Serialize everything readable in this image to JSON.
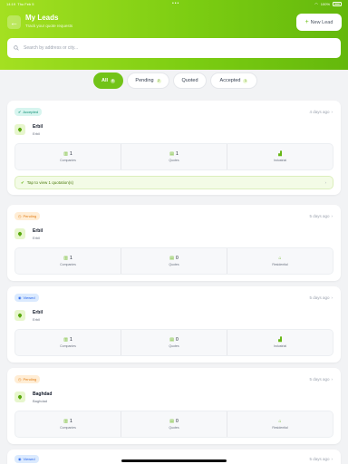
{
  "status_bar": {
    "time": "14:19",
    "date": "Thu Feb 5",
    "dots": "•••",
    "battery": "100%"
  },
  "header": {
    "title": "My Leads",
    "subtitle": "Track your quote requests",
    "new_lead_label": "New Lead",
    "back_icon": "arrow-left-icon"
  },
  "search": {
    "placeholder": "Search by address or city..."
  },
  "tabs": [
    {
      "label": "All",
      "count": "6",
      "active": true
    },
    {
      "label": "Pending",
      "count": "2",
      "active": false
    },
    {
      "label": "Quoted",
      "count": "",
      "active": false
    },
    {
      "label": "Accepted",
      "count": "1",
      "active": false
    }
  ],
  "cards": [
    {
      "status": "Accepted",
      "ago": "4 days ago",
      "city": "Erbil",
      "area": "Erbil",
      "companies": "1",
      "companies_label": "Companies",
      "quotes": "1",
      "quotes_label": "Quotes",
      "type": "Industrial",
      "tip": "Tap to view 1 quotation(s)"
    },
    {
      "status": "Pending",
      "ago": "5 days ago",
      "city": "Erbil",
      "area": "Erbil",
      "companies": "1",
      "companies_label": "Companies",
      "quotes": "0",
      "quotes_label": "Quotes",
      "type": "Residential"
    },
    {
      "status": "Viewed",
      "ago": "5 days ago",
      "city": "Erbil",
      "area": "Erbil",
      "companies": "1",
      "companies_label": "Companies",
      "quotes": "0",
      "quotes_label": "Quotes",
      "type": "Industrial"
    },
    {
      "status": "Pending",
      "ago": "5 days ago",
      "city": "Baghdad",
      "area": "Baghdad",
      "companies": "1",
      "companies_label": "Companies",
      "quotes": "0",
      "quotes_label": "Quotes",
      "type": "Residential"
    },
    {
      "status": "Viewed",
      "ago": "5 days ago"
    }
  ],
  "colors": {
    "accent": "#72c318",
    "accepted": "#0f8f74",
    "pending": "#e07b12",
    "viewed": "#2563eb"
  }
}
